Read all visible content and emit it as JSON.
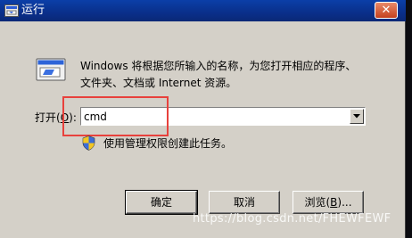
{
  "window": {
    "title": "运行",
    "close_label": "✕"
  },
  "description": {
    "line1": "Windows 将根据您所输入的名称，为您打开相应的程序、",
    "line2": "文件夹、文档或 Internet 资源。"
  },
  "open_field": {
    "label_prefix": "打开(",
    "label_accel": "O",
    "label_suffix": "):",
    "value": "cmd"
  },
  "admin_note": "使用管理权限创建此任务。",
  "buttons": {
    "ok": "确定",
    "cancel": "取消",
    "browse_prefix": "浏览(",
    "browse_accel": "B",
    "browse_suffix": ")..."
  },
  "watermark": "https://blog.csdn.net/FHEWFEWF",
  "colors": {
    "highlight": "#e8413c",
    "titlebar": "#0a2f8a",
    "dialog_bg": "#d4d0c8"
  },
  "icons": {
    "title": "run-icon",
    "main": "run-icon",
    "admin": "uac-shield-icon",
    "dropdown": "chevron-down-icon"
  }
}
